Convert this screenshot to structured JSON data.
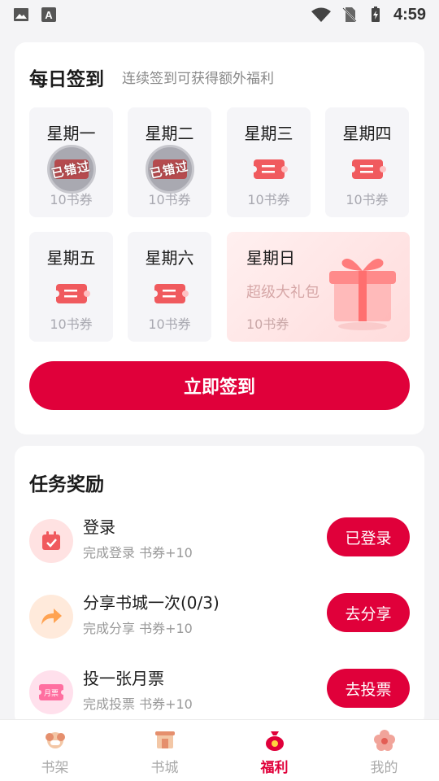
{
  "status": {
    "time": "4:59"
  },
  "sign": {
    "title": "每日签到",
    "subtitle": "连续签到可获得额外福利",
    "missed_label": "已错过",
    "days": [
      {
        "name": "星期一",
        "reward": "10书券",
        "state": "missed"
      },
      {
        "name": "星期二",
        "reward": "10书券",
        "state": "missed"
      },
      {
        "name": "星期三",
        "reward": "10书券",
        "state": "pending"
      },
      {
        "name": "星期四",
        "reward": "10书券",
        "state": "pending"
      },
      {
        "name": "星期五",
        "reward": "10书券",
        "state": "pending"
      },
      {
        "name": "星期六",
        "reward": "10书券",
        "state": "pending"
      }
    ],
    "sunday": {
      "name": "星期日",
      "sub": "超级大礼包",
      "reward": "10书券"
    },
    "button": "立即签到"
  },
  "tasks": {
    "title": "任务奖励",
    "items": [
      {
        "title": "登录",
        "desc": "完成登录  书券+10",
        "button": "已登录",
        "icon": "calendar-icon"
      },
      {
        "title": "分享书城一次(0/3)",
        "desc": "完成分享  书券+10",
        "button": "去分享",
        "icon": "share-icon"
      },
      {
        "title": "投一张月票",
        "desc": "完成投票  书券+10",
        "button": "去投票",
        "icon": "monthly-ticket-icon",
        "icon_text": "月票"
      }
    ]
  },
  "tabs": [
    {
      "label": "书架",
      "icon": "bookshelf-icon",
      "active": false
    },
    {
      "label": "书城",
      "icon": "bookstore-icon",
      "active": false
    },
    {
      "label": "福利",
      "icon": "welfare-bag-icon",
      "active": true
    },
    {
      "label": "我的",
      "icon": "profile-flower-icon",
      "active": false
    }
  ],
  "colors": {
    "accent": "#e0003a",
    "ticket": "#f05a5e"
  }
}
